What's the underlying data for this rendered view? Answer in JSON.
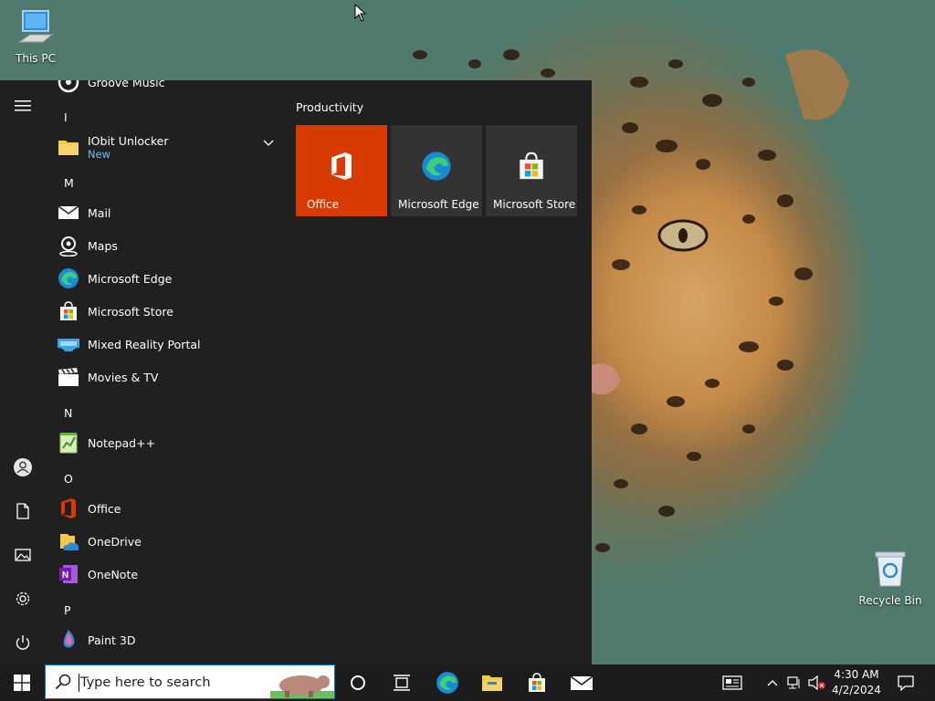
{
  "desktop": {
    "icons": [
      {
        "label": "This PC"
      },
      {
        "label": "Recycle Bin"
      }
    ]
  },
  "start_menu": {
    "apps": [
      {
        "name": "Groove Music",
        "icon": "groove-music-icon"
      },
      {
        "letter": "I"
      },
      {
        "name": "IObit Unlocker",
        "sub": "New",
        "icon": "folder-icon"
      },
      {
        "letter": "M"
      },
      {
        "name": "Mail",
        "icon": "mail-icon"
      },
      {
        "name": "Maps",
        "icon": "maps-icon"
      },
      {
        "name": "Microsoft Edge",
        "icon": "edge-icon"
      },
      {
        "name": "Microsoft Store",
        "icon": "store-icon"
      },
      {
        "name": "Mixed Reality Portal",
        "icon": "mixed-reality-icon"
      },
      {
        "name": "Movies & TV",
        "icon": "movies-icon"
      },
      {
        "letter": "N"
      },
      {
        "name": "Notepad++",
        "icon": "notepad-plus-plus-icon"
      },
      {
        "letter": "O"
      },
      {
        "name": "Office",
        "icon": "office-icon"
      },
      {
        "name": "OneDrive",
        "icon": "onedrive-icon"
      },
      {
        "name": "OneNote",
        "icon": "onenote-icon"
      },
      {
        "letter": "P"
      },
      {
        "name": "Paint 3D",
        "icon": "paint-3d-icon"
      }
    ],
    "group_title": "Productivity",
    "tiles": [
      {
        "label": "Office",
        "color": "#d83b01"
      },
      {
        "label": "Microsoft Edge",
        "color": "#333333"
      },
      {
        "label": "Microsoft Store",
        "color": "#333333"
      }
    ]
  },
  "taskbar": {
    "search_placeholder": "Type here to search",
    "clock_time": "4:30 AM",
    "clock_date": "4/2/2024"
  },
  "colors": {
    "accent": "#0078d7",
    "office_red": "#d83b01",
    "start_bg": "#202020",
    "taskbar_bg": "#1c1c1c",
    "new_badge": "#78b8ff"
  }
}
